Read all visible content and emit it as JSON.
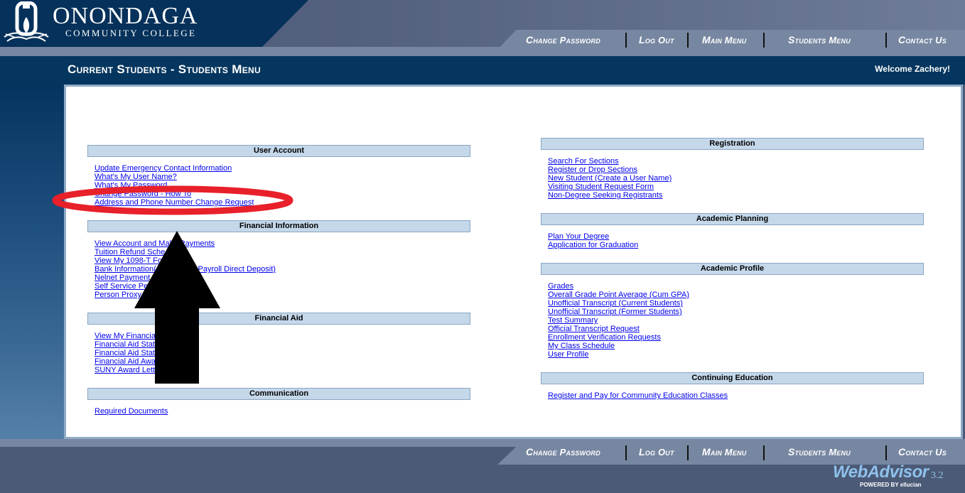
{
  "header": {
    "college_name": "ONONDAGA",
    "college_subtitle": "COMMUNITY COLLEGE",
    "nav": [
      {
        "label": "Change Password"
      },
      {
        "label": "Log Out"
      },
      {
        "label": "Main Menu"
      },
      {
        "label": "Students Menu"
      },
      {
        "label": "Contact Us"
      }
    ]
  },
  "titlebar": {
    "title": "Current Students - Students Menu",
    "welcome": "Welcome Zachery!"
  },
  "left_column": [
    {
      "heading": "User Account",
      "links": [
        "Update Emergency Contact Information",
        "What's My User Name?",
        "What's My Password",
        "Change Password - How To",
        "Address and Phone Number Change Request"
      ]
    },
    {
      "heading": "Financial Information",
      "links": [
        "View Account and Make Payments",
        "Tuition Refund Sche…",
        "View My 1098-T Fo…",
        "Bank Information(… …ble for Payroll Direct Deposit)",
        "Nelnet Payment …",
        "Self Service Pe…",
        "Person Proxy … …tion"
      ]
    },
    {
      "heading": "Financial Aid",
      "links": [
        "View My Financia…",
        "Financial Aid Stat…",
        "Financial Aid Stat…",
        "Financial Aid Awa…",
        "SUNY Award Lett… …Sheet"
      ]
    },
    {
      "heading": "Communication",
      "links": [
        "Required Documents"
      ]
    }
  ],
  "right_column": [
    {
      "heading": "Registration",
      "links": [
        "Search For Sections",
        "Register or Drop Sections",
        "New Student (Create a User Name)",
        "Visiting Student Request Form",
        "Non-Degree Seeking Registrants"
      ]
    },
    {
      "heading": "Academic Planning",
      "links": [
        "Plan Your Degree",
        "Application for Graduation"
      ]
    },
    {
      "heading": "Academic Profile",
      "links": [
        "Grades",
        "Overall Grade Point Average (Cum GPA)",
        "Unofficial Transcript (Current Students)",
        "Unofficial Transcript (Former Students)",
        "Test Summary",
        "Official Transcript Request",
        "Enrollment Verification Requests",
        "My Class Schedule",
        "User Profile"
      ]
    },
    {
      "heading": "Continuing Education",
      "links": [
        "Register and Pay for Community Education Classes"
      ]
    }
  ],
  "footer": {
    "nav": [
      {
        "label": "Change Password"
      },
      {
        "label": "Log Out"
      },
      {
        "label": "Main Menu"
      },
      {
        "label": "Students Menu"
      },
      {
        "label": "Contact Us"
      }
    ],
    "brand": "WebAdvisor",
    "version": "3.2",
    "powered_by": "POWERED BY ellucian"
  },
  "annotations": {
    "highlight_color": "#e8202a",
    "arrow_color": "#000000",
    "highlighted_link": "Address and Phone Number Change Request"
  },
  "colors": {
    "link": "#0000ee",
    "section_header_bg": "#c4d8ea",
    "title_bar": "#05365f",
    "logo_bg": "#05315a"
  }
}
